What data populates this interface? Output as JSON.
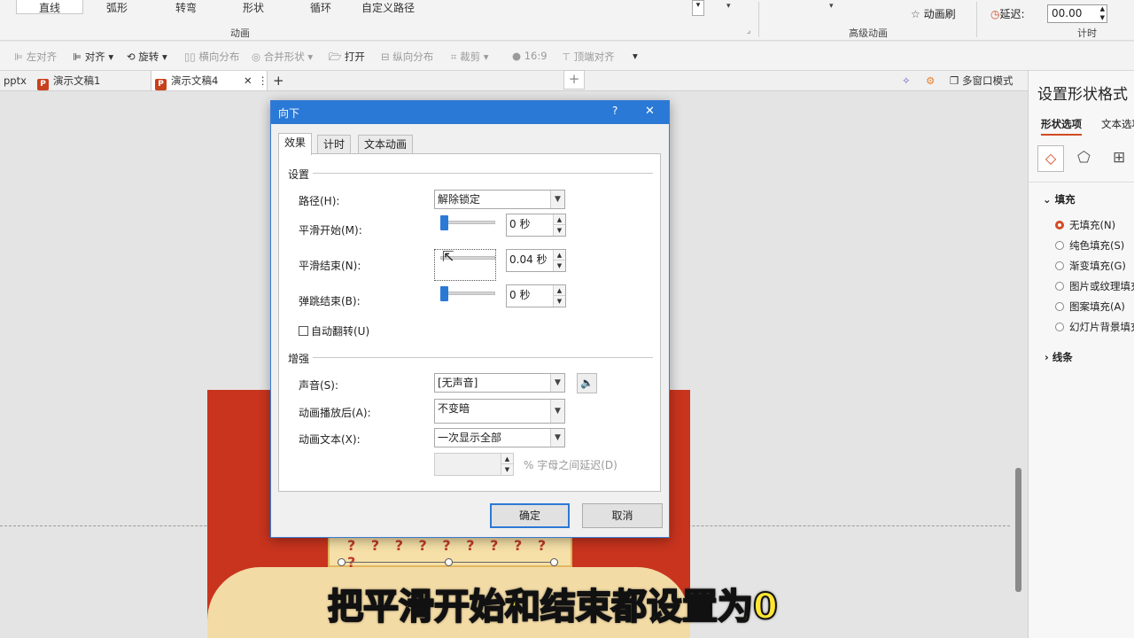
{
  "ribbon": {
    "animations": [
      "直线",
      "弧形",
      "转弯",
      "形状",
      "循环",
      "自定义路径"
    ],
    "group_animation": "动画",
    "group_advanced": "高级动画",
    "animation_painter": "动画刷",
    "delay_label": "延迟:",
    "delay_value": "00.00",
    "group_timing": "计时"
  },
  "toolbar": {
    "align_left": "左对齐",
    "align": "对齐",
    "rotate": "旋转",
    "distribute_h": "横向分布",
    "merge_shapes": "合并形状",
    "open": "打开",
    "distribute_v": "纵向分布",
    "crop": "裁剪",
    "ratio": "16:9",
    "align_top": "顶端对齐"
  },
  "doc_tabs": {
    "tab0": "pptx",
    "tab1": "演示文稿1",
    "tab2": "演示文稿4",
    "multi_window": "多窗口模式"
  },
  "right_pane": {
    "title": "设置形状格式",
    "tab_shape": "形状选项",
    "tab_text": "文本选项",
    "fill_header": "填充",
    "options": [
      "无填充(N)",
      "纯色填充(S)",
      "渐变填充(G)",
      "图片或纹理填充",
      "图案填充(A)",
      "幻灯片背景填充"
    ],
    "line_header": "线条"
  },
  "dialog": {
    "title": "向下",
    "help": "?",
    "close": "✕",
    "tabs": [
      "效果",
      "计时",
      "文本动画"
    ],
    "section_settings": "设置",
    "path_label": "路径(H):",
    "path_value": "解除锁定",
    "smooth_start_label": "平滑开始(M):",
    "smooth_start_value": "0 秒",
    "smooth_end_label": "平滑结束(N):",
    "smooth_end_value": "0.04 秒",
    "bounce_end_label": "弹跳结束(B):",
    "bounce_end_value": "0 秒",
    "auto_reverse_label": "自动翻转(U)",
    "section_enhance": "增强",
    "sound_label": "声音(S):",
    "sound_value": "[无声音]",
    "after_anim_label": "动画播放后(A):",
    "after_anim_value": "不变暗",
    "anim_text_label": "动画文本(X):",
    "anim_text_value": "一次显示全部",
    "letter_delay_label": "% 字母之间延迟(D)",
    "ok": "确定",
    "cancel": "取消"
  },
  "caption": "把平滑开始和结束都设置为0"
}
